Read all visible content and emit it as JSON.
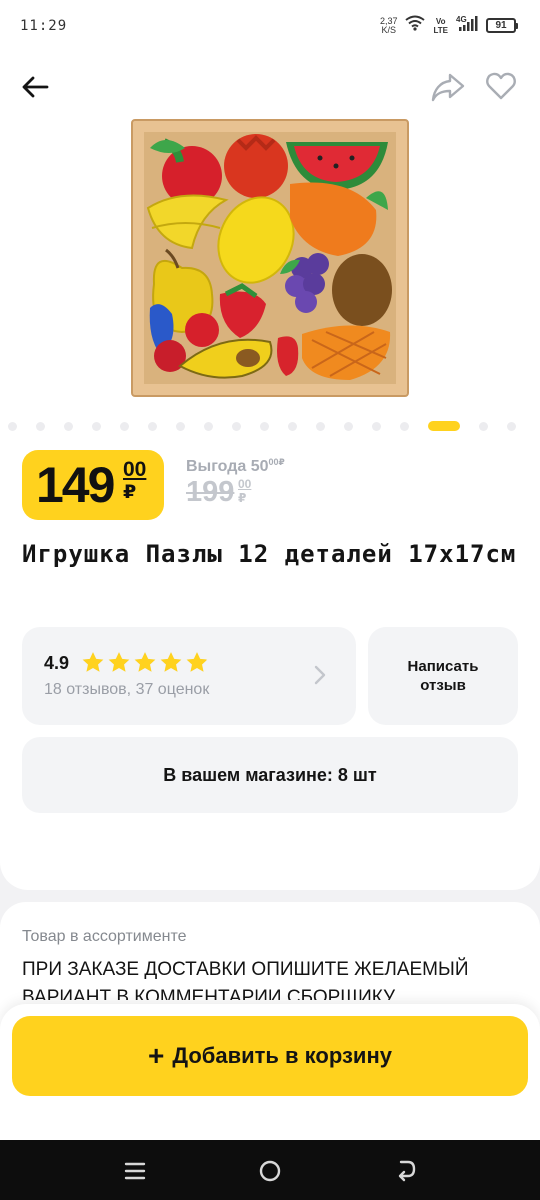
{
  "status_bar": {
    "time": "11:29",
    "net_speed_value": "2,37",
    "net_speed_unit": "K/S",
    "volte_top": "Vo",
    "volte_bottom": "LTE",
    "network": "4G",
    "battery": "91"
  },
  "header": {
    "back_icon": "arrow-left-icon",
    "share_icon": "share-icon",
    "favorite_icon": "heart-outline-icon"
  },
  "gallery": {
    "image_icon": "fruit-puzzle-photo",
    "dot_count": 18,
    "active_index": 15,
    "dot_color": "#ececef",
    "active_dot_color": "#ffd21e"
  },
  "price": {
    "current_int": "149",
    "current_dec": "00",
    "currency": "₽",
    "discount_label": "Выгода 50",
    "discount_sup": "00",
    "discount_currency": "₽",
    "old_int": "199",
    "old_dec": "00",
    "old_currency": "₽",
    "badge_color": "#ffd21e"
  },
  "product": {
    "title": "Игрушка Пазлы 12 деталей 17х17см"
  },
  "rating": {
    "value": "4.9",
    "stars": 4.9,
    "reviews_text": "18 отзывов, 37 оценок",
    "star_color": "#ffd21e"
  },
  "review_button": {
    "label": "Написать отзыв"
  },
  "store": {
    "stock_text": "В вашем магазине: 8 шт"
  },
  "info": {
    "assortment": "Товар в ассортименте",
    "note": "ПРИ ЗАКАЗЕ ДОСТАВКИ ОПИШИТЕ ЖЕЛАЕМЫЙ ВАРИАНТ В КОММЕНТАРИИ СБОРЩИКУ"
  },
  "cart": {
    "plus": "+",
    "label": "Добавить в корзину"
  },
  "navbar": {
    "menu_icon": "menu-lines-icon",
    "home_icon": "home-circle-icon",
    "back_icon": "back-arrow-icon"
  }
}
